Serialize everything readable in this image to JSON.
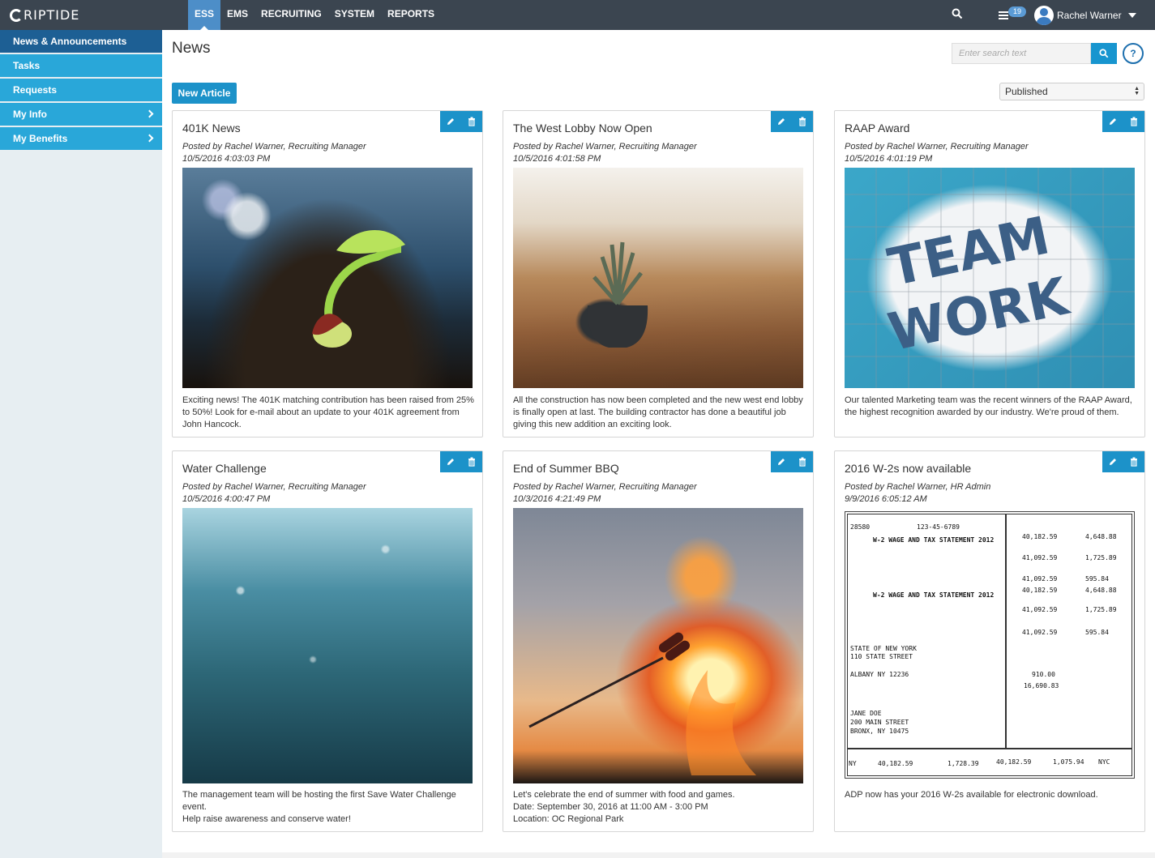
{
  "app": {
    "logo": "RIPTIDE"
  },
  "nav": {
    "items": [
      "ESS",
      "EMS",
      "RECRUITING",
      "SYSTEM",
      "REPORTS"
    ],
    "active": "ESS"
  },
  "topbar": {
    "task_count": "19",
    "user_name": "Rachel Warner"
  },
  "sidebar": {
    "items": [
      {
        "label": "News & Announcements",
        "active": true
      },
      {
        "label": "Tasks"
      },
      {
        "label": "Requests"
      },
      {
        "label": "My Info",
        "has_submenu": true
      },
      {
        "label": "My Benefits",
        "has_submenu": true
      }
    ]
  },
  "page": {
    "title": "News",
    "search_placeholder": "Enter search text",
    "help_label": "?",
    "new_article_label": "New Article",
    "status_filter": "Published"
  },
  "articles": [
    {
      "title": "401K News",
      "posted_by": "Posted by Rachel Warner, Recruiting Manager",
      "date": "10/5/2016 4:03:03 PM",
      "image": "seedling sprouting from soil",
      "body": [
        "Exciting news! The 401K matching contribution has been raised from 25% to 50%!  Look for e-mail about an  update to your 401K agreement from John Hancock."
      ]
    },
    {
      "title": "The West Lobby Now Open",
      "posted_by": "Posted by Rachel Warner, Recruiting Manager",
      "date": "10/5/2016 4:01:58 PM",
      "image": "potted plant on wooden table",
      "body": [
        "All the construction has now been completed and the new west end lobby is finally open at last. The building contractor has done a beautiful job giving this new addition an exciting look."
      ]
    },
    {
      "title": "RAAP Award",
      "posted_by": "Posted by Rachel Warner, Recruiting Manager",
      "date": "10/5/2016 4:01:19 PM",
      "image": "team work puzzle",
      "body": [
        "Our talented Marketing team was the recent winners of the RAAP Award, the highest recognition awarded by our industry. We're proud of them."
      ]
    },
    {
      "title": "Water Challenge",
      "posted_by": "Posted by Rachel Warner, Recruiting Manager",
      "date": "10/5/2016 4:00:47 PM",
      "image": "water surface",
      "body": [
        "The management team will be hosting the first Save Water Challenge event.",
        "Help raise awareness and conserve water!"
      ]
    },
    {
      "title": "End of Summer BBQ",
      "posted_by": "Posted by Rachel Warner, Recruiting Manager",
      "date": "10/3/2016 4:21:49 PM",
      "image": "roasting over campfire",
      "body": [
        "Let's celebrate the end of summer with food and games.",
        "Date: September 30, 2016 at 11:00 AM - 3:00 PM",
        "Location: OC Regional Park"
      ]
    },
    {
      "title": "2016 W-2s now available",
      "posted_by": "Posted by Rachel Warner, HR Admin",
      "date": "9/9/2016 6:05:12 AM",
      "image": "W-2 wage and tax statement form",
      "body": [
        "ADP now has your 2016 W-2s available for electronic download."
      ]
    }
  ],
  "w2_form": {
    "heading": "W-2 WAGE AND TAX STATEMENT 2012",
    "control": "28580",
    "ssn": "123-45-6789",
    "wages": "40,182.59",
    "fed_tax": "4,648.88",
    "ss_wages": "41,092.59",
    "ss_tax": "1,725.89",
    "medicare_tax": "595.84",
    "employer": [
      "STATE OF NEW YORK",
      "110 STATE STREET",
      "ALBANY NY 12236"
    ],
    "employee": [
      "JANE DOE",
      "200 MAIN STREET",
      "BRONX, NY 10475"
    ],
    "box12e": "910.00",
    "box12dd": "16,690.83",
    "state": "NY",
    "state_tax": "1,728.39",
    "local_tax": "1,075.94",
    "locality": "NYC"
  },
  "colors": {
    "topbar": "#3b4550",
    "accent": "#1c92c9",
    "sidebar_active": "#1d5f94",
    "sidebar_item": "#29a7d9"
  }
}
